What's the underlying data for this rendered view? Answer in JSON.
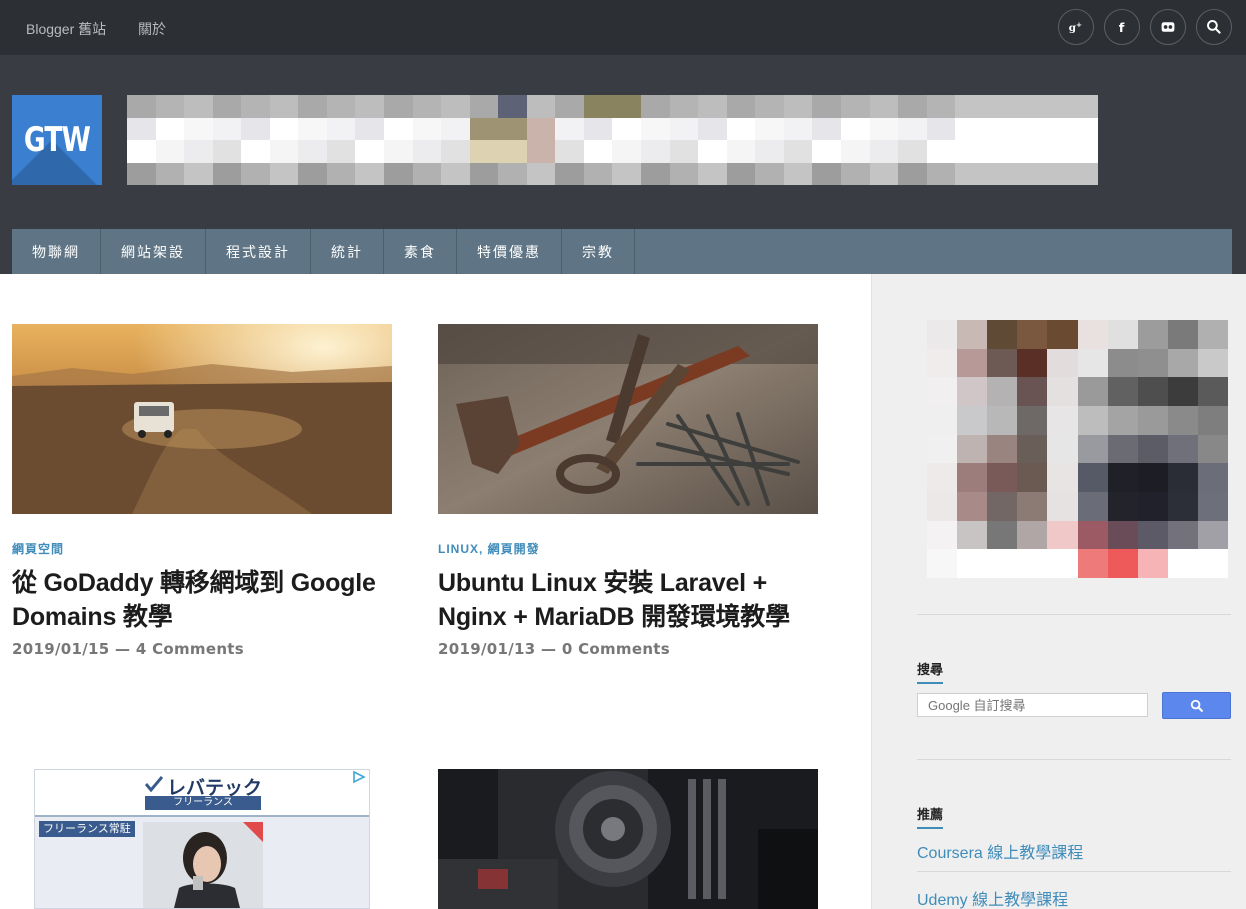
{
  "topbar": {
    "links": [
      "Blogger 舊站",
      "關於"
    ],
    "social": [
      "google-plus-icon",
      "facebook-icon",
      "flickr-icon",
      "search-icon"
    ]
  },
  "header": {
    "logo_text": "GTW"
  },
  "nav": {
    "items": [
      "物聯網",
      "網站架設",
      "程式設計",
      "統計",
      "素食",
      "特價優惠",
      "宗教"
    ]
  },
  "posts": [
    {
      "categories": [
        "網頁空間"
      ],
      "title": "從 GoDaddy 轉移網域到 Google Domains 教學",
      "date": "2019/01/15",
      "separator": " — ",
      "comments": "4 Comments"
    },
    {
      "categories": [
        "LINUX",
        "網頁開發"
      ],
      "category_separator": ", ",
      "title": "Ubuntu Linux 安裝 Laravel + Nginx + MariaDB 開發環境教學",
      "date": "2019/01/13",
      "separator": " — ",
      "comments": "0 Comments"
    }
  ],
  "ad": {
    "brand": "レバテック",
    "brand_sub": "フリーランス",
    "tag": "フリーランス常駐"
  },
  "sidebar": {
    "search_title": "搜尋",
    "search_placeholder": "Google 自訂搜尋",
    "recommend_title": "推薦",
    "recommend_links": [
      "Coursera 線上教學課程",
      "Udemy 線上教學課程"
    ]
  },
  "colors": {
    "topbar_bg": "#2c2f33",
    "header_bg": "#393d43",
    "nav_bg": "#5f7585",
    "accent": "#3f8cba",
    "logo_bg": "#3b7fd1",
    "search_button": "#5c87ec"
  }
}
